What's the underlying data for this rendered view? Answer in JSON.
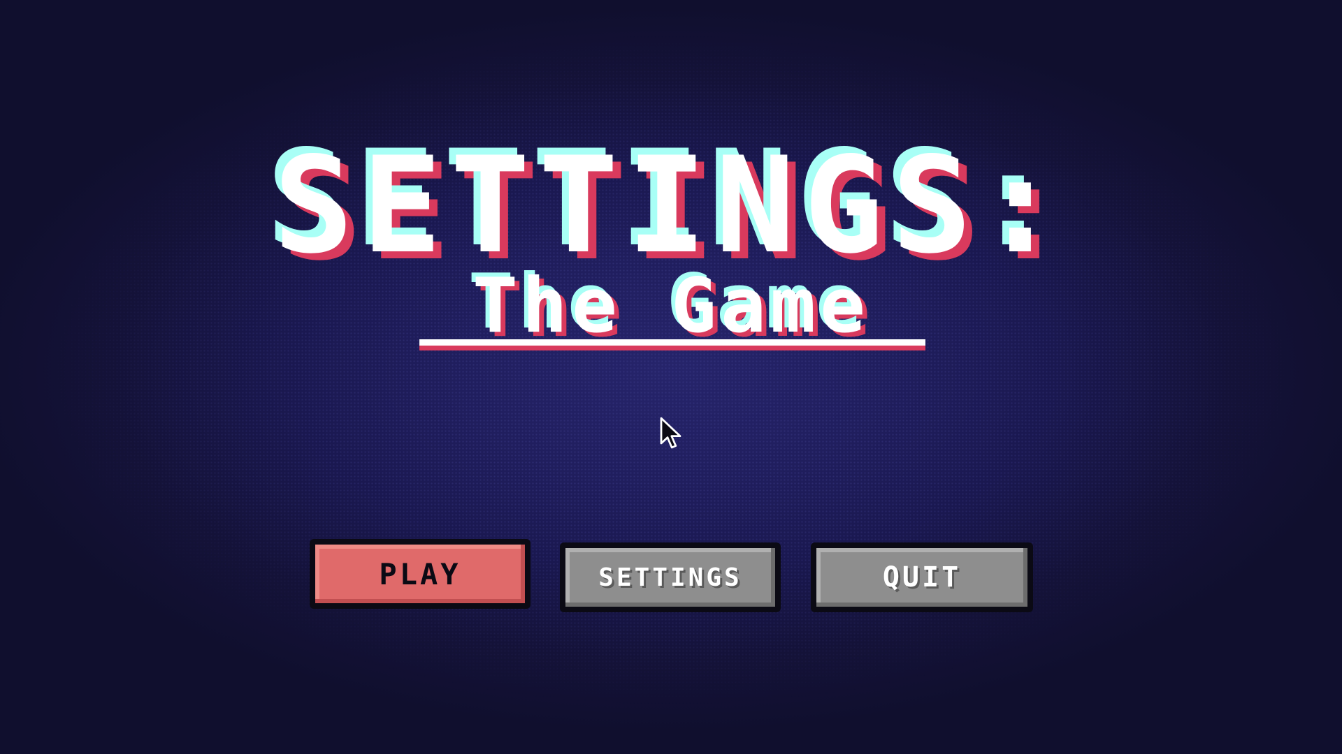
{
  "title": {
    "main": "SETTINGS:",
    "subtitle": "The Game"
  },
  "menu": {
    "play_label": "PLAY",
    "settings_label": "SETTINGS",
    "quit_label": "QUIT"
  },
  "colors": {
    "background": "#100f2e",
    "title_text": "#ffffff",
    "title_cyan_shadow": "#a8fff6",
    "title_red_shadow": "#d93a5d",
    "play_button": "#e06a6a",
    "secondary_button": "#8e8e8e",
    "button_border": "#0b0a14"
  },
  "icons": {
    "cursor": "mouse-pointer-icon"
  }
}
